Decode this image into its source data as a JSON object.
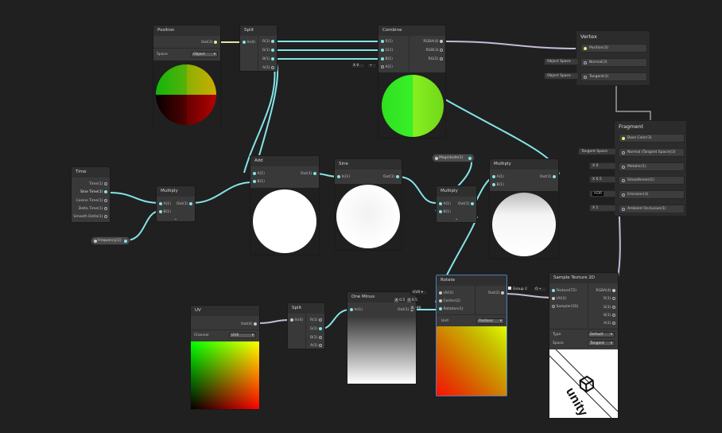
{
  "nodes": {
    "position": {
      "title": "Position",
      "out": "Out(3)",
      "space_label": "Space",
      "space_value": "Object"
    },
    "split1": {
      "title": "Split",
      "in": "In(4)",
      "outs": [
        "R(1)",
        "G(1)",
        "B(1)",
        "A(1)"
      ]
    },
    "combine": {
      "title": "Combine",
      "ins": [
        "R(1)",
        "G(1)",
        "B(1)",
        "A(1)"
      ],
      "outs": [
        "RGBA(4)",
        "RGB(3)",
        "RG(2)"
      ],
      "a_field_x": "X",
      "a_field_val": "0"
    },
    "time": {
      "title": "Time",
      "outs": [
        "Time(1)",
        "Sine Time(1)",
        "Cosine Time(1)",
        "Delta Time(1)",
        "Smooth Delta(1)"
      ]
    },
    "multiply1": {
      "title": "Multiply",
      "ins": [
        "A(1)",
        "B(1)"
      ],
      "out": "Out(1)"
    },
    "add": {
      "title": "Add",
      "ins": [
        "A(1)",
        "B(1)"
      ],
      "out": "Out(1)"
    },
    "sine": {
      "title": "Sine",
      "in": "In(1)",
      "out": "Out(1)"
    },
    "multiply2": {
      "title": "Multiply",
      "ins": [
        "A(1)",
        "B(1)"
      ],
      "out": "Out(1)"
    },
    "multiply3": {
      "title": "Multiply",
      "ins": [
        "A(1)",
        "B(1)"
      ],
      "out": "Out(1)"
    },
    "uv": {
      "title": "UV",
      "out": "Out(4)",
      "channel_label": "Channel",
      "channel_value": "UV0"
    },
    "split2": {
      "title": "Split",
      "in": "In(4)",
      "outs": [
        "R(1)",
        "G(1)",
        "B(1)",
        "A(1)"
      ]
    },
    "one_minus": {
      "title": "One Minus",
      "in": "In(1)",
      "out": "Out(1)"
    },
    "rotate": {
      "title": "Rotate",
      "ins": [
        "UV(2)",
        "Center(2)",
        "Rotation(1)"
      ],
      "out": "Out(2)",
      "unit_label": "Unit",
      "unit_value": "Radians"
    },
    "sample_texture": {
      "title": "Sample Texture 2D",
      "ins": [
        "Texture(T2)",
        "UV(2)",
        "Sampler(SS)"
      ],
      "outs": [
        "RGBA(4)",
        "R(1)",
        "G(1)",
        "B(1)",
        "A(1)"
      ],
      "type_label": "Type",
      "type_value": "Default",
      "space_label": "Space",
      "space_value": "Tangent",
      "logo_text": "unity"
    }
  },
  "properties": {
    "frequency": "Frequency(1)",
    "magnitude": "Magnitude(1)"
  },
  "inline_inputs": {
    "rotate_uv": "UV0",
    "center_x_label": "X",
    "center_x": "0.5",
    "center_y_label": "Y",
    "center_y": "0.5",
    "rotation_x_label": "X",
    "rotation_x": "-90",
    "group": "Group 2",
    "texture_field": "O"
  },
  "vertex": {
    "title": "Vertex",
    "slots": [
      "Position(3)",
      "Normal(3)",
      "Tangent(3)"
    ],
    "side_inputs": [
      "Object Space",
      "Object Space"
    ]
  },
  "fragment": {
    "title": "Fragment",
    "slots": [
      "Base Color(3)",
      "Normal (Tangent Space)(3)",
      "Metallic(1)",
      "Smoothness(1)",
      "Emission(3)",
      "Ambient Occlusion(1)"
    ],
    "side_inputs": {
      "normal": "Tangent Space",
      "metallic_label": "X",
      "metallic": "0",
      "smoothness_label": "X",
      "smoothness": "0.5",
      "emission": "HDR",
      "ao_label": "X",
      "ao": "1"
    }
  },
  "colors": {
    "background": "#202020",
    "node_body": "#393939",
    "node_header": "#2f2f2f",
    "float_wire": "#84e4e7",
    "vector_wire": "#c6b9d6",
    "selected_outline": "#4c7fb5"
  }
}
